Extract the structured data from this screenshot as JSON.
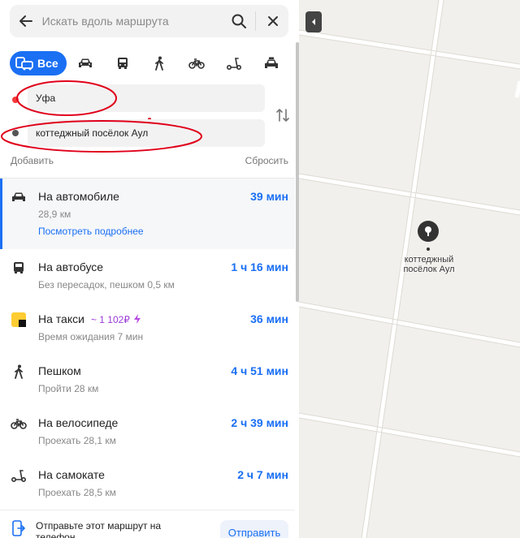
{
  "search": {
    "placeholder": "Искать вдоль маршрута"
  },
  "modes": {
    "all_label": "Все",
    "items": [
      "car-icon",
      "bus-icon",
      "walk-icon",
      "bicycle-icon",
      "scooter-icon",
      "taxi-icon"
    ]
  },
  "points": {
    "from": "Уфа",
    "to": "коттеджный посёлок Аул"
  },
  "actions": {
    "add": "Добавить",
    "reset": "Сбросить"
  },
  "routes": [
    {
      "icon": "car-icon",
      "name": "На автомобиле",
      "time": "39 мин",
      "sub": "28,9 км",
      "link": "Посмотреть подробнее"
    },
    {
      "icon": "bus-icon",
      "name": "На автобусе",
      "time": "1 ч 16 мин",
      "sub": "Без пересадок, пешком 0,5 км"
    },
    {
      "icon": "yandex-taxi-icon",
      "name": "На такси",
      "price": "~ 1 102₽",
      "time": "36 мин",
      "sub": "Время ожидания 7 мин"
    },
    {
      "icon": "walk-icon",
      "name": "Пешком",
      "time": "4 ч 51 мин",
      "sub": "Пройти 28 км"
    },
    {
      "icon": "bicycle-icon",
      "name": "На велосипеде",
      "time": "2 ч 39 мин",
      "sub": "Проехать 28,1 км"
    },
    {
      "icon": "scooter-icon",
      "name": "На самокате",
      "time": "2 ч 7 мин",
      "sub": "Проехать 28,5 км"
    }
  ],
  "send": {
    "text": "Отправьте этот маршрут на телефон",
    "button": "Отправить"
  },
  "map": {
    "pin_label": "коттеджный посёлок Аул"
  },
  "colors": {
    "accent": "#1a6ff3",
    "from_dot": "#f33a3a",
    "annotation": "#e0001b",
    "taxi_price": "#9b3ad9"
  }
}
